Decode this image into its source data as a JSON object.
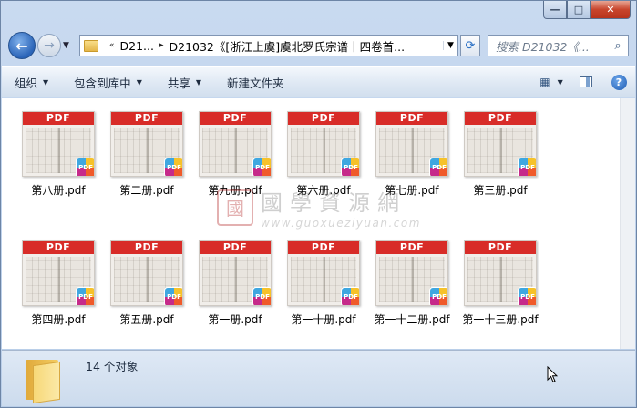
{
  "window": {
    "caption": {
      "minimize": "—",
      "maximize": "□",
      "close": "✕"
    }
  },
  "nav": {
    "back_glyph": "←",
    "forward_glyph": "→",
    "history_drop": "▼",
    "address": {
      "overflow": "«",
      "crumbs": [
        "D21...",
        "D21032《[浙江上虞]虞北罗氏宗谱十四卷首..."
      ],
      "separator": "▸",
      "drop": "▼"
    },
    "refresh_glyph": "⟳",
    "search": {
      "placeholder": "搜索 D21032《...",
      "icon": "search-icon"
    }
  },
  "toolbar": {
    "organize": "组织",
    "include_library": "包含到库中",
    "share": "共享",
    "new_folder": "新建文件夹",
    "arrow": "▼",
    "view_icon": "view-options-icon",
    "help": "?"
  },
  "files": [
    {
      "name": "第八册.pdf"
    },
    {
      "name": "第二册.pdf"
    },
    {
      "name": "第九册.pdf"
    },
    {
      "name": "第六册.pdf"
    },
    {
      "name": "第七册.pdf"
    },
    {
      "name": "第三册.pdf"
    },
    {
      "name": "第四册.pdf"
    },
    {
      "name": "第五册.pdf"
    },
    {
      "name": "第一册.pdf"
    },
    {
      "name": "第一十册.pdf"
    },
    {
      "name": "第一十二册.pdf"
    },
    {
      "name": "第一十三册.pdf"
    }
  ],
  "thumb_label": "PDF",
  "badge_label": "PDF",
  "watermark": {
    "seal": "國",
    "text": "國學資源網",
    "url": "www.guoxueziyuan.com"
  },
  "status": {
    "count": "14 个对象"
  },
  "colors": {
    "pdf_band": "#d82c28",
    "accent": "#2a64b8"
  }
}
